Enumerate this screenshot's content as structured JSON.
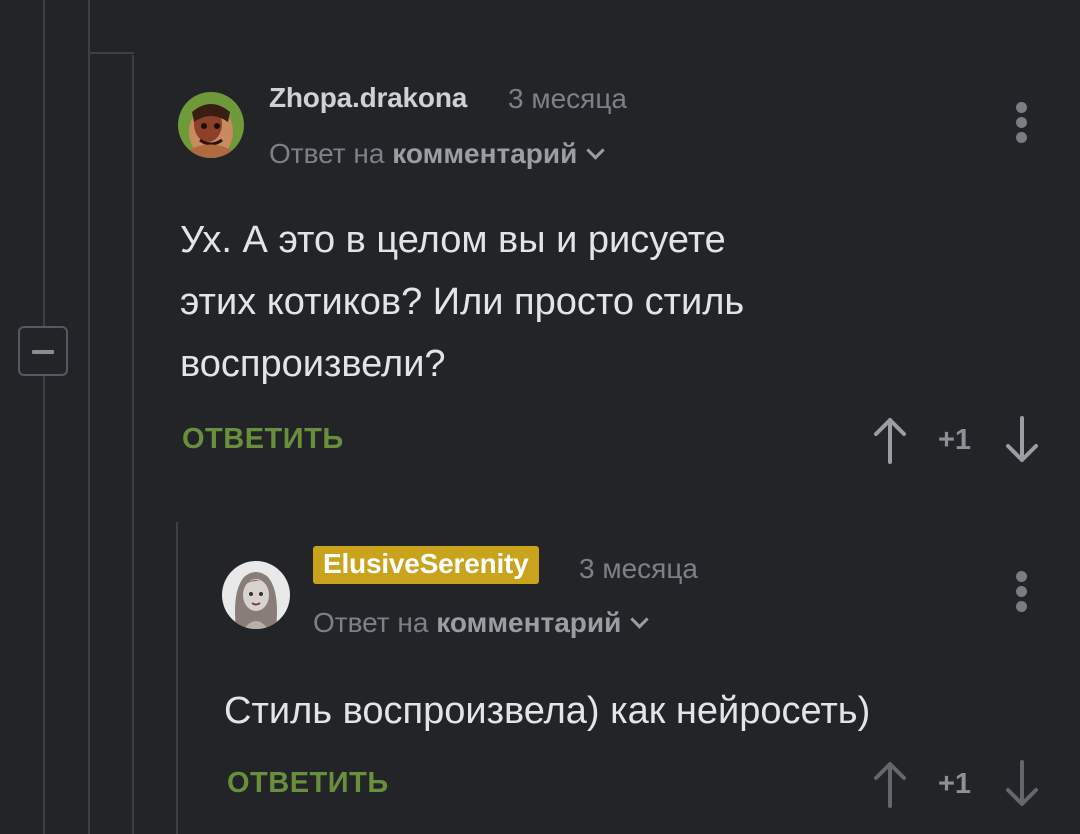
{
  "comments": [
    {
      "username": "Zhopa.drakona",
      "time": "3 месяца",
      "reply_prefix": "Ответ на",
      "reply_target": "комментарий",
      "text_lines": [
        "Ух. А это в целом вы и рисуете",
        "этих котиков? Или просто стиль",
        "воспроизвели?"
      ],
      "reply_label": "ОТВЕТИТЬ",
      "score": "+1"
    },
    {
      "username": "ElusiveSerenity",
      "time": "3 месяца",
      "reply_prefix": "Ответ на",
      "reply_target": "комментарий",
      "text_lines": [
        "Стиль воспроизвела) как нейросеть)"
      ],
      "reply_label": "ОТВЕТИТЬ",
      "score": "+1"
    }
  ],
  "colors": {
    "background": "#222428",
    "reply_button": "#6a8f3c",
    "author_highlight": "#c9a31c"
  },
  "icons": [
    "collapse-thread-icon",
    "more-options-icon",
    "chevron-down-icon",
    "upvote-arrow-icon",
    "downvote-arrow-icon"
  ]
}
